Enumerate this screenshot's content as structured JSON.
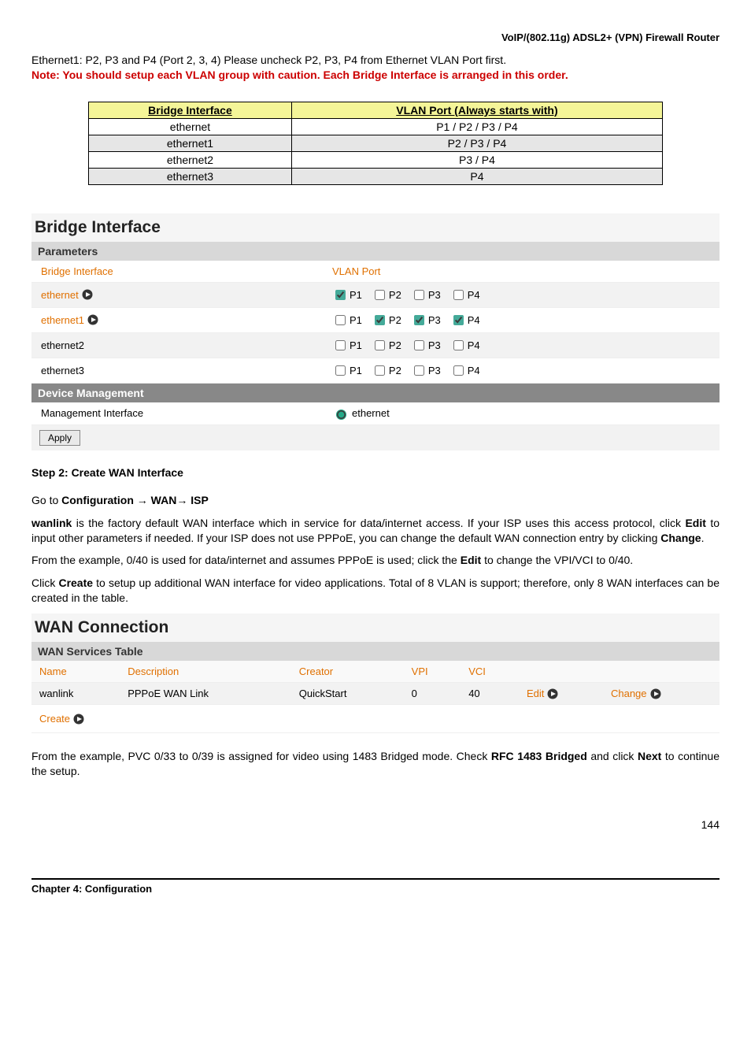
{
  "header": {
    "title": "VoIP/(802.11g) ADSL2+ (VPN) Firewall Router"
  },
  "intro": {
    "line1": "Ethernet1: P2, P3 and P4 (Port 2, 3, 4) Please uncheck P2, P3, P4 from Ethernet VLAN Port first.",
    "note_label": "Note:",
    "note_text": " You should setup each VLAN group with caution.    Each Bridge Interface is arranged in this order."
  },
  "bi_header_a": "Bridge Interface",
  "bi_header_b": "VLAN Port (Always starts with)",
  "bi_rows": [
    {
      "iface": "ethernet",
      "ports": "P1 / P2 / P3 / P4"
    },
    {
      "iface": "ethernet1",
      "ports": "P2 / P3 / P4"
    },
    {
      "iface": "ethernet2",
      "ports": "P3 / P4"
    },
    {
      "iface": "ethernet3",
      "ports": "P4"
    }
  ],
  "bridge_panel": {
    "title": "Bridge Interface",
    "sub1": "Parameters",
    "col_a": "Bridge Interface",
    "col_b": "VLAN Port",
    "rows": [
      {
        "name": "ethernet",
        "link": true,
        "p1": true,
        "p2": false,
        "p3": false,
        "p4": false
      },
      {
        "name": "ethernet1",
        "link": true,
        "p1": false,
        "p2": true,
        "p3": true,
        "p4": true
      },
      {
        "name": "ethernet2",
        "link": false,
        "p1": false,
        "p2": false,
        "p3": false,
        "p4": false
      },
      {
        "name": "ethernet3",
        "link": false,
        "p1": false,
        "p2": false,
        "p3": false,
        "p4": false
      }
    ],
    "p_labels": {
      "p1": "P1",
      "p2": "P2",
      "p3": "P3",
      "p4": "P4"
    },
    "sub2": "Device Management",
    "mgmt_label": "Management Interface",
    "mgmt_value": "ethernet",
    "apply": "Apply"
  },
  "step2": {
    "heading": "Step 2: Create WAN Interface",
    "goto_prefix": "Go to ",
    "goto_bold": "Configuration → WAN→ ISP",
    "para1_a": "wanlink",
    "para1_b": " is the factory default WAN interface which in service for data/internet access. If your ISP uses this access protocol, click ",
    "para1_c": "Edit",
    "para1_d": " to input other parameters if needed.   If your ISP does not use PPPoE, you can change the default WAN connection entry by clicking ",
    "para1_e": "Change",
    "para1_f": ".",
    "para2_a": "From the example, 0/40 is used for data/internet and assumes PPPoE is used; click the ",
    "para2_b": "Edit",
    "para2_c": " to change the VPI/VCI to 0/40.",
    "para3_a": "Click ",
    "para3_b": "Create",
    "para3_c": " to setup up additional WAN interface for video applications. Total of 8 VLAN is support; therefore, only 8 WAN interfaces can be created in the table."
  },
  "wan_panel": {
    "title": "WAN Connection",
    "sub": "WAN Services Table",
    "cols": {
      "name": "Name",
      "desc": "Description",
      "creator": "Creator",
      "vpi": "VPI",
      "vci": "VCI"
    },
    "row": {
      "name": "wanlink",
      "desc": "PPPoE WAN Link",
      "creator": "QuickStart",
      "vpi": "0",
      "vci": "40",
      "edit": "Edit",
      "change": "Change"
    },
    "create": "Create"
  },
  "closing": {
    "a": "From the example, PVC 0/33 to 0/39 is assigned for video using 1483 Bridged mode.    Check ",
    "b": "RFC 1483 Bridged",
    "c": " and click ",
    "d": "Next",
    "e": " to continue the setup."
  },
  "footer": {
    "chapter": "Chapter 4: Configuration",
    "page": "144"
  }
}
